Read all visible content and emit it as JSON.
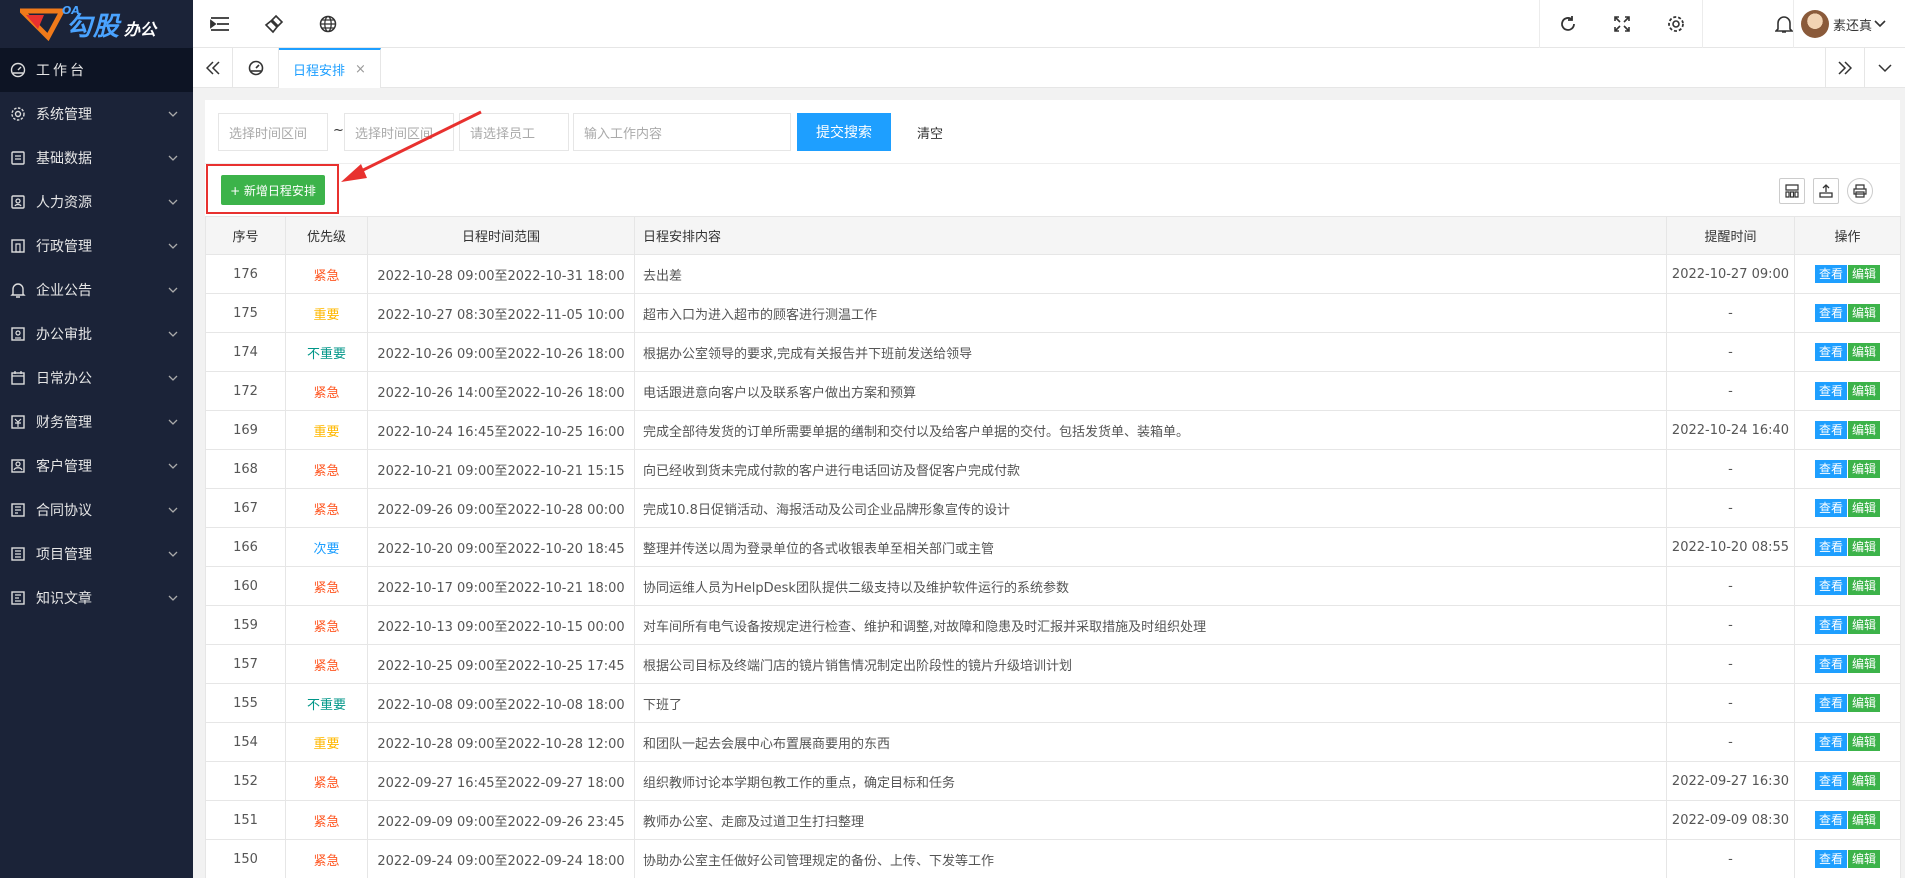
{
  "brand": {
    "letters": "OA",
    "name": "勾股",
    "sub": "办公"
  },
  "sidebar": {
    "items": [
      {
        "label": "工作台",
        "icon": "dashboard-icon",
        "active": true
      },
      {
        "label": "系统管理",
        "icon": "gear-icon"
      },
      {
        "label": "基础数据",
        "icon": "database-icon"
      },
      {
        "label": "人力资源",
        "icon": "user-card-icon"
      },
      {
        "label": "行政管理",
        "icon": "building-icon"
      },
      {
        "label": "企业公告",
        "icon": "bell-icon"
      },
      {
        "label": "办公审批",
        "icon": "approval-icon"
      },
      {
        "label": "日常办公",
        "icon": "calendar-icon"
      },
      {
        "label": "财务管理",
        "icon": "money-icon"
      },
      {
        "label": "客户管理",
        "icon": "customer-icon"
      },
      {
        "label": "合同协议",
        "icon": "contract-icon"
      },
      {
        "label": "项目管理",
        "icon": "project-icon"
      },
      {
        "label": "知识文章",
        "icon": "article-icon"
      }
    ]
  },
  "header": {
    "user_name": "素还真"
  },
  "tabs": {
    "active_label": "日程安排",
    "close": "×"
  },
  "search": {
    "start_placeholder": "选择时间区间",
    "tilde": "~",
    "end_placeholder": "选择时间区间",
    "employee_placeholder": "请选择员工",
    "content_placeholder": "输入工作内容",
    "submit_label": "提交搜索",
    "clear_label": "清空"
  },
  "toolbar": {
    "add_label": "+ 新增日程安排"
  },
  "table": {
    "headers": [
      "序号",
      "优先级",
      "日程时间范围",
      "日程安排内容",
      "提醒时间",
      "操作"
    ],
    "view_label": "查看",
    "edit_label": "编辑",
    "rows": [
      {
        "id": "176",
        "priority": "紧急",
        "level": "urgent",
        "range": "2022-10-28 09:00至2022-10-31 18:00",
        "content": "去出差",
        "remind": "2022-10-27 09:00"
      },
      {
        "id": "175",
        "priority": "重要",
        "level": "important",
        "range": "2022-10-27 08:30至2022-11-05 10:00",
        "content": "超市入口为进入超市的顾客进行测温工作",
        "remind": "-"
      },
      {
        "id": "174",
        "priority": "不重要",
        "level": "normal",
        "range": "2022-10-26 09:00至2022-10-26 18:00",
        "content": "根据办公室领导的要求,完成有关报告并下班前发送给领导",
        "remind": "-"
      },
      {
        "id": "172",
        "priority": "紧急",
        "level": "urgent",
        "range": "2022-10-26 14:00至2022-10-26 18:00",
        "content": "电话跟进意向客户以及联系客户做出方案和预算",
        "remind": "-"
      },
      {
        "id": "169",
        "priority": "重要",
        "level": "important",
        "range": "2022-10-24 16:45至2022-10-25 16:00",
        "content": "完成全部待发货的订单所需要单据的缮制和交付以及给客户单据的交付。包括发货单、装箱单。",
        "remind": "2022-10-24 16:40"
      },
      {
        "id": "168",
        "priority": "紧急",
        "level": "urgent",
        "range": "2022-10-21 09:00至2022-10-21 15:15",
        "content": "向已经收到货未完成付款的客户进行电话回访及督促客户完成付款",
        "remind": "-"
      },
      {
        "id": "167",
        "priority": "紧急",
        "level": "urgent",
        "range": "2022-09-26 09:00至2022-10-28 00:00",
        "content": "完成10.8日促销活动、海报活动及公司企业品牌形象宣传的设计",
        "remind": "-"
      },
      {
        "id": "166",
        "priority": "次要",
        "level": "minor",
        "range": "2022-10-20 09:00至2022-10-20 18:45",
        "content": "整理并传送以周为登录单位的各式收银表单至相关部门或主管",
        "remind": "2022-10-20 08:55"
      },
      {
        "id": "160",
        "priority": "紧急",
        "level": "urgent",
        "range": "2022-10-17 09:00至2022-10-21 18:00",
        "content": "协同运维人员为HelpDesk团队提供二级支持以及维护软件运行的系统参数",
        "remind": "-"
      },
      {
        "id": "159",
        "priority": "紧急",
        "level": "urgent",
        "range": "2022-10-13 09:00至2022-10-15 00:00",
        "content": "对车间所有电气设备按规定进行检查、维护和调整,对故障和隐患及时汇报并采取措施及时组织处理",
        "remind": "-"
      },
      {
        "id": "157",
        "priority": "紧急",
        "level": "urgent",
        "range": "2022-10-25 09:00至2022-10-25 17:45",
        "content": "根据公司目标及终端门店的镜片销售情况制定出阶段性的镜片升级培训计划",
        "remind": "-"
      },
      {
        "id": "155",
        "priority": "不重要",
        "level": "normal",
        "range": "2022-10-08 09:00至2022-10-08 18:00",
        "content": "下班了",
        "remind": "-"
      },
      {
        "id": "154",
        "priority": "重要",
        "level": "important",
        "range": "2022-10-28 09:00至2022-10-28 12:00",
        "content": "和团队一起去会展中心布置展商要用的东西",
        "remind": "-"
      },
      {
        "id": "152",
        "priority": "紧急",
        "level": "urgent",
        "range": "2022-09-27 16:45至2022-09-27 18:00",
        "content": "组织教师讨论本学期包教工作的重点，确定目标和任务",
        "remind": "2022-09-27 16:30"
      },
      {
        "id": "151",
        "priority": "紧急",
        "level": "urgent",
        "range": "2022-09-09 09:00至2022-09-26 23:45",
        "content": "教师办公室、走廊及过道卫生打扫整理",
        "remind": "2022-09-09 08:30"
      },
      {
        "id": "150",
        "priority": "紧急",
        "level": "urgent",
        "range": "2022-09-24 09:00至2022-09-24 18:00",
        "content": "协助办公室主任做好公司管理规定的备份、上传、下发等工作",
        "remind": "-"
      }
    ]
  }
}
